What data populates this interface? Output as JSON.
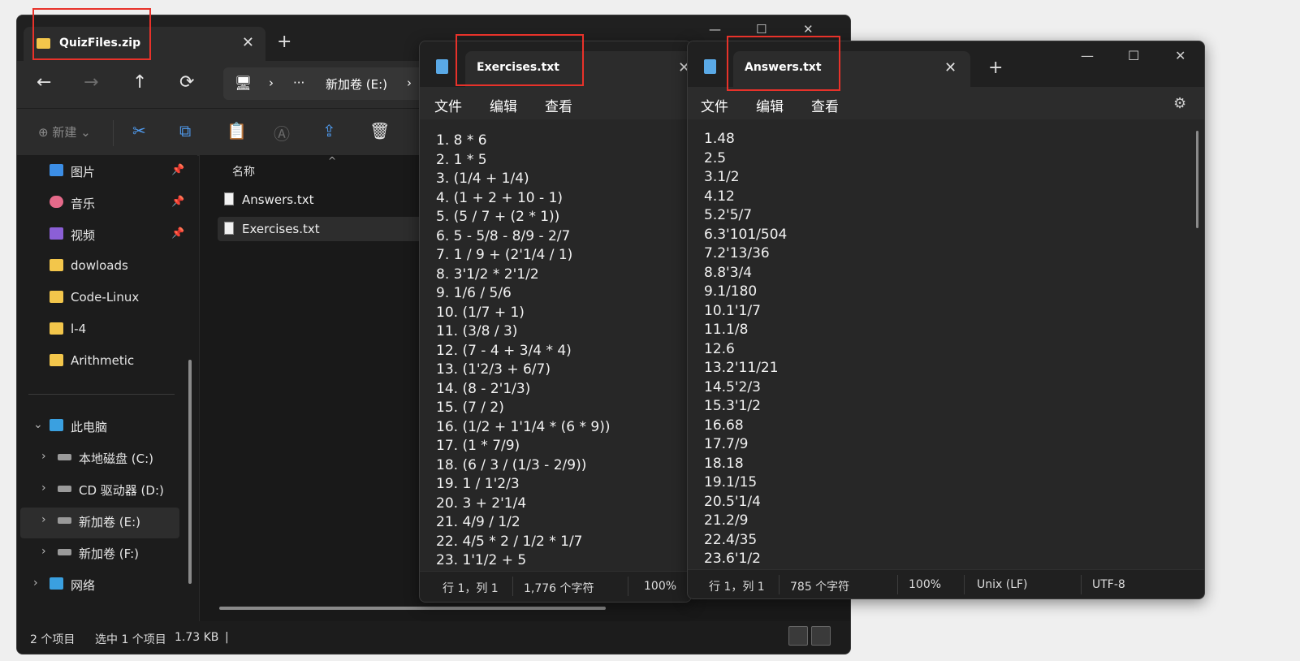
{
  "explorer": {
    "tab_title": "QuizFiles.zip",
    "tab_close": "✕",
    "new_tab": "+",
    "window_controls": [
      "—",
      "☐",
      "✕"
    ],
    "nav": {
      "back": "←",
      "forward": "→",
      "up": "↑",
      "refresh": "⟳"
    },
    "breadcrumb": [
      "🖥",
      "›",
      "···",
      "新加卷 (E:)",
      "›"
    ],
    "toolbar": {
      "new_label": "⊕ 新建 ⌄",
      "cut": "✂",
      "copy": "⧉",
      "paste": "📋",
      "rename": "Ⓐ",
      "share": "⇪",
      "delete": "🗑"
    },
    "sidebar": {
      "quick_access": [
        {
          "label": "图片",
          "icon": "pictures-icon",
          "color": "#3c8ee6",
          "pinned": true
        },
        {
          "label": "音乐",
          "icon": "music-icon",
          "color": "#e56a8a",
          "pinned": true
        },
        {
          "label": "视频",
          "icon": "video-icon",
          "color": "#8b5fd6",
          "pinned": true
        },
        {
          "label": "dowloads",
          "icon": "folder-icon",
          "color": "#f3c64b",
          "pinned": false
        },
        {
          "label": "Code-Linux",
          "icon": "folder-icon",
          "color": "#f3c64b",
          "pinned": false
        },
        {
          "label": "l-4",
          "icon": "folder-icon",
          "color": "#f3c64b",
          "pinned": false
        },
        {
          "label": "Arithmetic",
          "icon": "folder-icon",
          "color": "#f3c64b",
          "pinned": false
        }
      ],
      "pin_glyph": "📌",
      "this_pc": "此电脑",
      "drives": [
        "本地磁盘 (C:)",
        "CD 驱动器 (D:)",
        "新加卷 (E:)",
        "新加卷 (F:)"
      ],
      "network": "网络",
      "chev_down": "⌄",
      "chev_right": "›"
    },
    "column_header": "名称",
    "sort_glyph": "^",
    "files": [
      "Answers.txt",
      "Exercises.txt"
    ],
    "status": {
      "count": "2 个项目",
      "selected": "选中 1 个项目",
      "size": "1.73 KB",
      "bar": "|"
    }
  },
  "exercises": {
    "tab_title": "Exercises.txt",
    "tab_close": "✕",
    "menu": [
      "文件",
      "编辑",
      "查看"
    ],
    "lines": [
      "1. 8 * 6",
      "2. 1 * 5",
      "3. (1/4 + 1/4)",
      "4. (1 + 2 + 10 - 1)",
      "5. (5 / 7 + (2 * 1))",
      "6. 5 - 5/8 - 8/9 - 2/7",
      "7. 1 / 9 + (2'1/4 / 1)",
      "8. 3'1/2 * 2'1/2",
      "9. 1/6 / 5/6",
      "10. (1/7 + 1)",
      "11. (3/8 / 3)",
      "12. (7 - 4 + 3/4 * 4)",
      "13. (1'2/3 + 6/7)",
      "14. (8 - 2'1/3)",
      "15. (7 / 2)",
      "16. (1/2 + 1'1/4 * (6 * 9))",
      "17. (1 * 7/9)",
      "18. (6 / 3 / (1/3 - 2/9))",
      "19. 1 / 1'2/3",
      "20. 3 + 2'1/4",
      "21. 4/9 / 1/2",
      "22. 4/5 * 2 / 1/2 * 1/7",
      "23. 1'1/2 + 5"
    ],
    "status": {
      "position": "行 1，列 1",
      "chars": "1,776 个字符",
      "zoom": "100%"
    }
  },
  "answers": {
    "tab_title": "Answers.txt",
    "tab_close": "✕",
    "new_tab": "+",
    "window_controls": [
      "—",
      "☐",
      "✕"
    ],
    "menu": [
      "文件",
      "编辑",
      "查看"
    ],
    "settings_glyph": "⚙",
    "lines": [
      "1.48",
      "2.5",
      "3.1/2",
      "4.12",
      "5.2'5/7",
      "6.3'101/504",
      "7.2'13/36",
      "8.8'3/4",
      "9.1/180",
      "10.1'1/7",
      "11.1/8",
      "12.6",
      "13.2'11/21",
      "14.5'2/3",
      "15.3'1/2",
      "16.68",
      "17.7/9",
      "18.18",
      "19.1/15",
      "20.5'1/4",
      "21.2/9",
      "22.4/35",
      "23.6'1/2"
    ],
    "status": {
      "position": "行 1，列 1",
      "chars": "785 个字符",
      "zoom": "100%",
      "eol": "Unix (LF)",
      "encoding": "UTF-8"
    }
  },
  "colors": {
    "highlight": "#e8322a",
    "accent": "#4f9bef",
    "folder": "#f3c64b",
    "notepad_icon": "#5aa9e6"
  }
}
